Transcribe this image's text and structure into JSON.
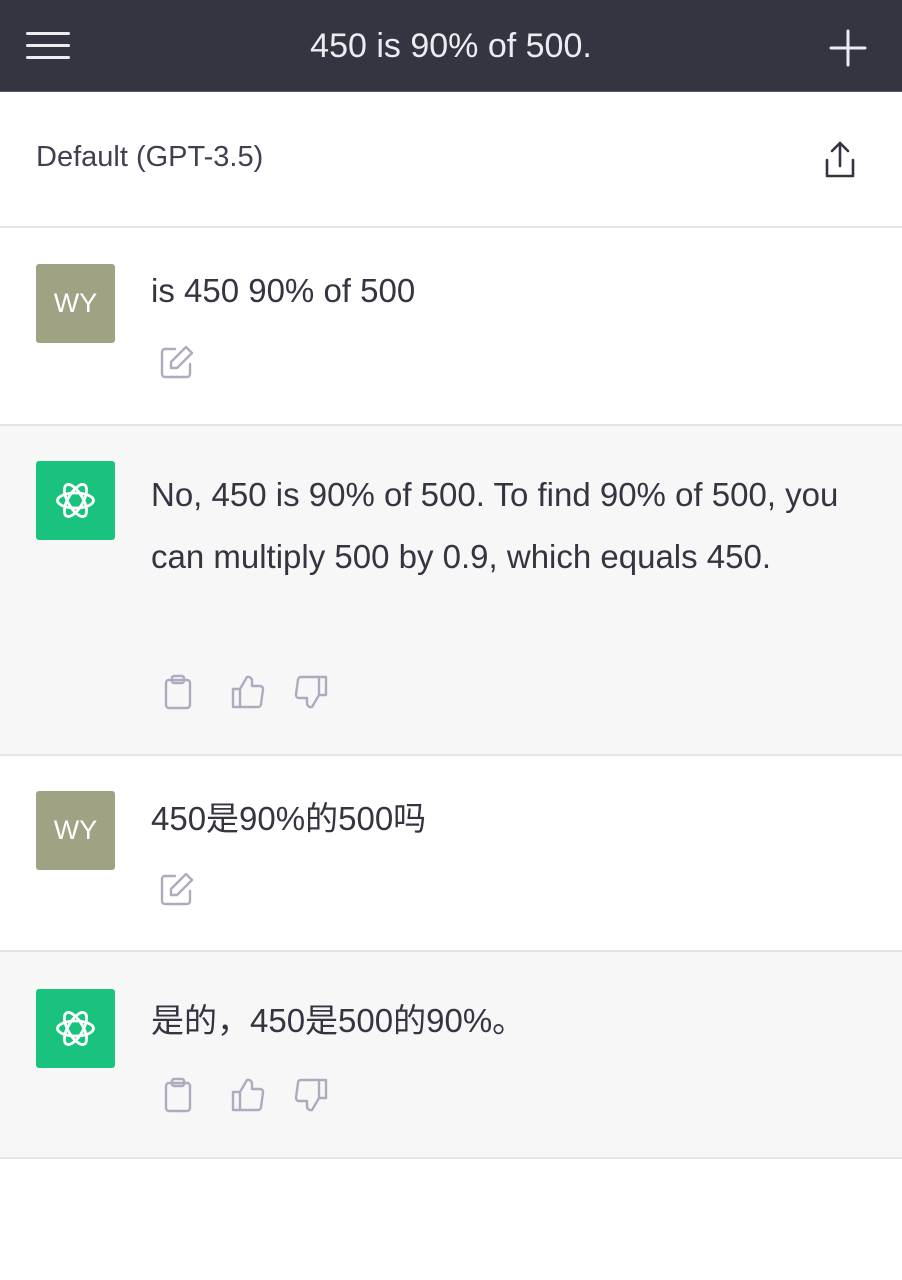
{
  "header": {
    "title": "450 is 90% of 500.",
    "menu_icon": "hamburger-menu-icon",
    "new_chat_icon": "plus-icon"
  },
  "model": {
    "label": "Default (GPT-3.5)",
    "share_icon": "share-icon"
  },
  "messages": [
    {
      "role": "user",
      "avatar_initials": "WY",
      "text": "is 450 90% of 500",
      "actions": [
        "edit-icon"
      ]
    },
    {
      "role": "assistant",
      "text": "No, 450 is 90% of 500. To find 90% of 500, you can multiply 500 by 0.9, which equals 450.",
      "actions": [
        "clipboard-icon",
        "thumbs-up-icon",
        "thumbs-down-icon"
      ]
    },
    {
      "role": "user",
      "avatar_initials": "WY",
      "text": "450是90%的500吗",
      "actions": [
        "edit-icon"
      ]
    },
    {
      "role": "assistant",
      "text": "是的，450是500的90%。",
      "actions": [
        "clipboard-icon",
        "thumbs-up-icon",
        "thumbs-down-icon"
      ]
    }
  ],
  "colors": {
    "header_bg": "#343541",
    "user_avatar_bg": "#9fa283",
    "assistant_avatar_bg": "#19c37d",
    "assistant_row_bg": "#f7f7f8"
  }
}
